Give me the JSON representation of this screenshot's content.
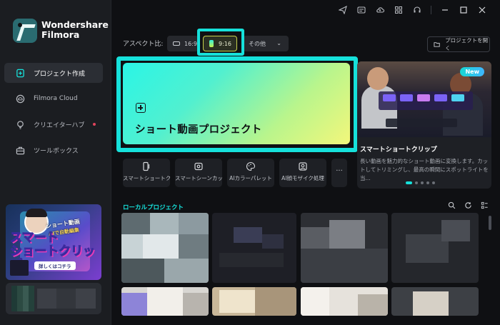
{
  "app": {
    "name_line1": "Wondershare",
    "name_line2": "Filmora"
  },
  "sidebar": {
    "items": [
      {
        "label": "プロジェクト作成",
        "icon": "new-project-icon",
        "active": true
      },
      {
        "label": "Filmora Cloud",
        "icon": "cloud-icon",
        "active": false
      },
      {
        "label": "クリエイターハブ",
        "icon": "lightbulb-icon",
        "active": false,
        "badge_dot": true
      },
      {
        "label": "ツールボックス",
        "icon": "toolbox-icon",
        "active": false
      }
    ],
    "promo": {
      "line1": "ショート動画",
      "line2": "AIで自動編集",
      "big_line1": "スマート",
      "big_line2": "ショートクリップ",
      "cta": "詳しくはコチラ"
    }
  },
  "topbar": {
    "icons": [
      "send-icon",
      "mail-icon",
      "cloud-upload-icon",
      "grid-icon",
      "headset-icon",
      "minimize-icon",
      "maximize-icon",
      "close-icon"
    ]
  },
  "aspect": {
    "label": "アスペクト比:",
    "options": [
      {
        "label": "16:9"
      },
      {
        "label": "9:16",
        "selected": true
      },
      {
        "label": "その他"
      }
    ]
  },
  "open_project": {
    "label": "プロジェクトを開く"
  },
  "create_card": {
    "title": "ショート動画プロジェクト"
  },
  "feature_card": {
    "badge": "New",
    "title": "スマートショートクリップ",
    "description": "長い動画を魅力的なショート動画に変換します。カットしてトリミングし、最高の瞬間にスポットライトを当..."
  },
  "tools": [
    {
      "label": "スマートショートク...",
      "icon": "smart-short-clip-icon"
    },
    {
      "label": "スマートシーンカット",
      "icon": "scene-cut-icon"
    },
    {
      "label": "AIカラーパレット",
      "icon": "color-palette-icon"
    },
    {
      "label": "AI顔モザイク処理",
      "icon": "face-mosaic-icon"
    }
  ],
  "local_projects": {
    "title": "ローカルプロジェクト"
  },
  "colors": {
    "accent": "#16e1db",
    "sidebar_bg": "#1b1d21",
    "page_bg": "#0f1013"
  }
}
